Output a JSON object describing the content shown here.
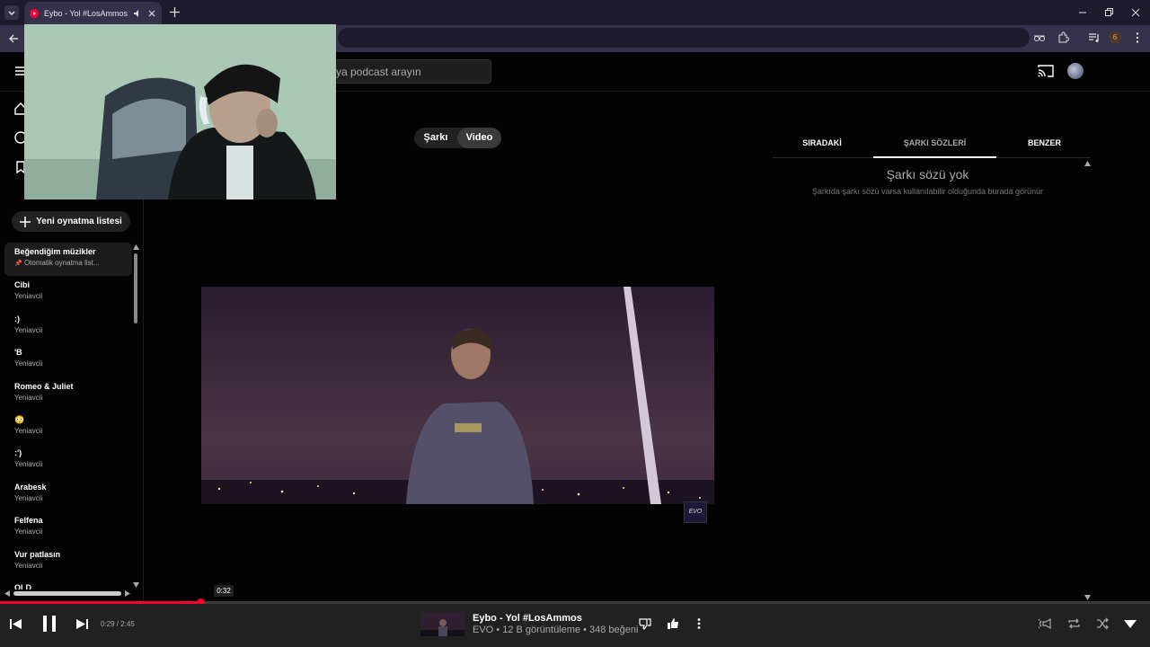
{
  "browser": {
    "tab_title": "Eybo - Yol #LosAmmos - Yo",
    "profile_badge": "6"
  },
  "header": {
    "search_placeholder": "ya podcast arayın"
  },
  "sidebar": {
    "new_playlist_label": "Yeni oynatma listesi",
    "playlists": [
      {
        "title": "Beğendiğim müzikler",
        "subtitle": "Otomatik oynatma list...",
        "pinned": true
      },
      {
        "title": "Cibi",
        "subtitle": "Yeniavcii"
      },
      {
        "title": ":)",
        "subtitle": "Yeniavcii"
      },
      {
        "title": "'B",
        "subtitle": "Yeniavcii"
      },
      {
        "title": "Romeo & Juliet",
        "subtitle": "Yeniavcii"
      },
      {
        "title": "😳",
        "subtitle": "Yeniavcii"
      },
      {
        "title": ":')",
        "subtitle": "Yeniavcii"
      },
      {
        "title": "Arabesk",
        "subtitle": "Yeniavcii"
      },
      {
        "title": "Felfena",
        "subtitle": "Yeniavcii"
      },
      {
        "title": "Vur patlasın",
        "subtitle": "Yeniavcii"
      },
      {
        "title": "OLD",
        "subtitle": ""
      }
    ]
  },
  "main": {
    "toggle_song": "Şarkı",
    "toggle_video": "Video",
    "video_channel_logo": "EVO"
  },
  "right_panel": {
    "tabs": [
      "SIRADAKİ",
      "ŞARKI SÖZLERİ",
      "BENZER"
    ],
    "active_tab": "ŞARKI SÖZLERİ",
    "no_lyrics_title": "Şarkı sözü yok",
    "no_lyrics_subtitle": "Şarkıda şarkı sözü varsa kullanılabilir olduğunda burada görünür"
  },
  "player": {
    "time": "0:29 / 2:45",
    "hover_time": "0:32",
    "progress_fraction": 0.176,
    "track_title": "Eybo - Yol #LosAmmos",
    "track_meta": "EVO • 12 B görüntüleme • 348 beğeni",
    "accent_color": "#ff0033"
  }
}
